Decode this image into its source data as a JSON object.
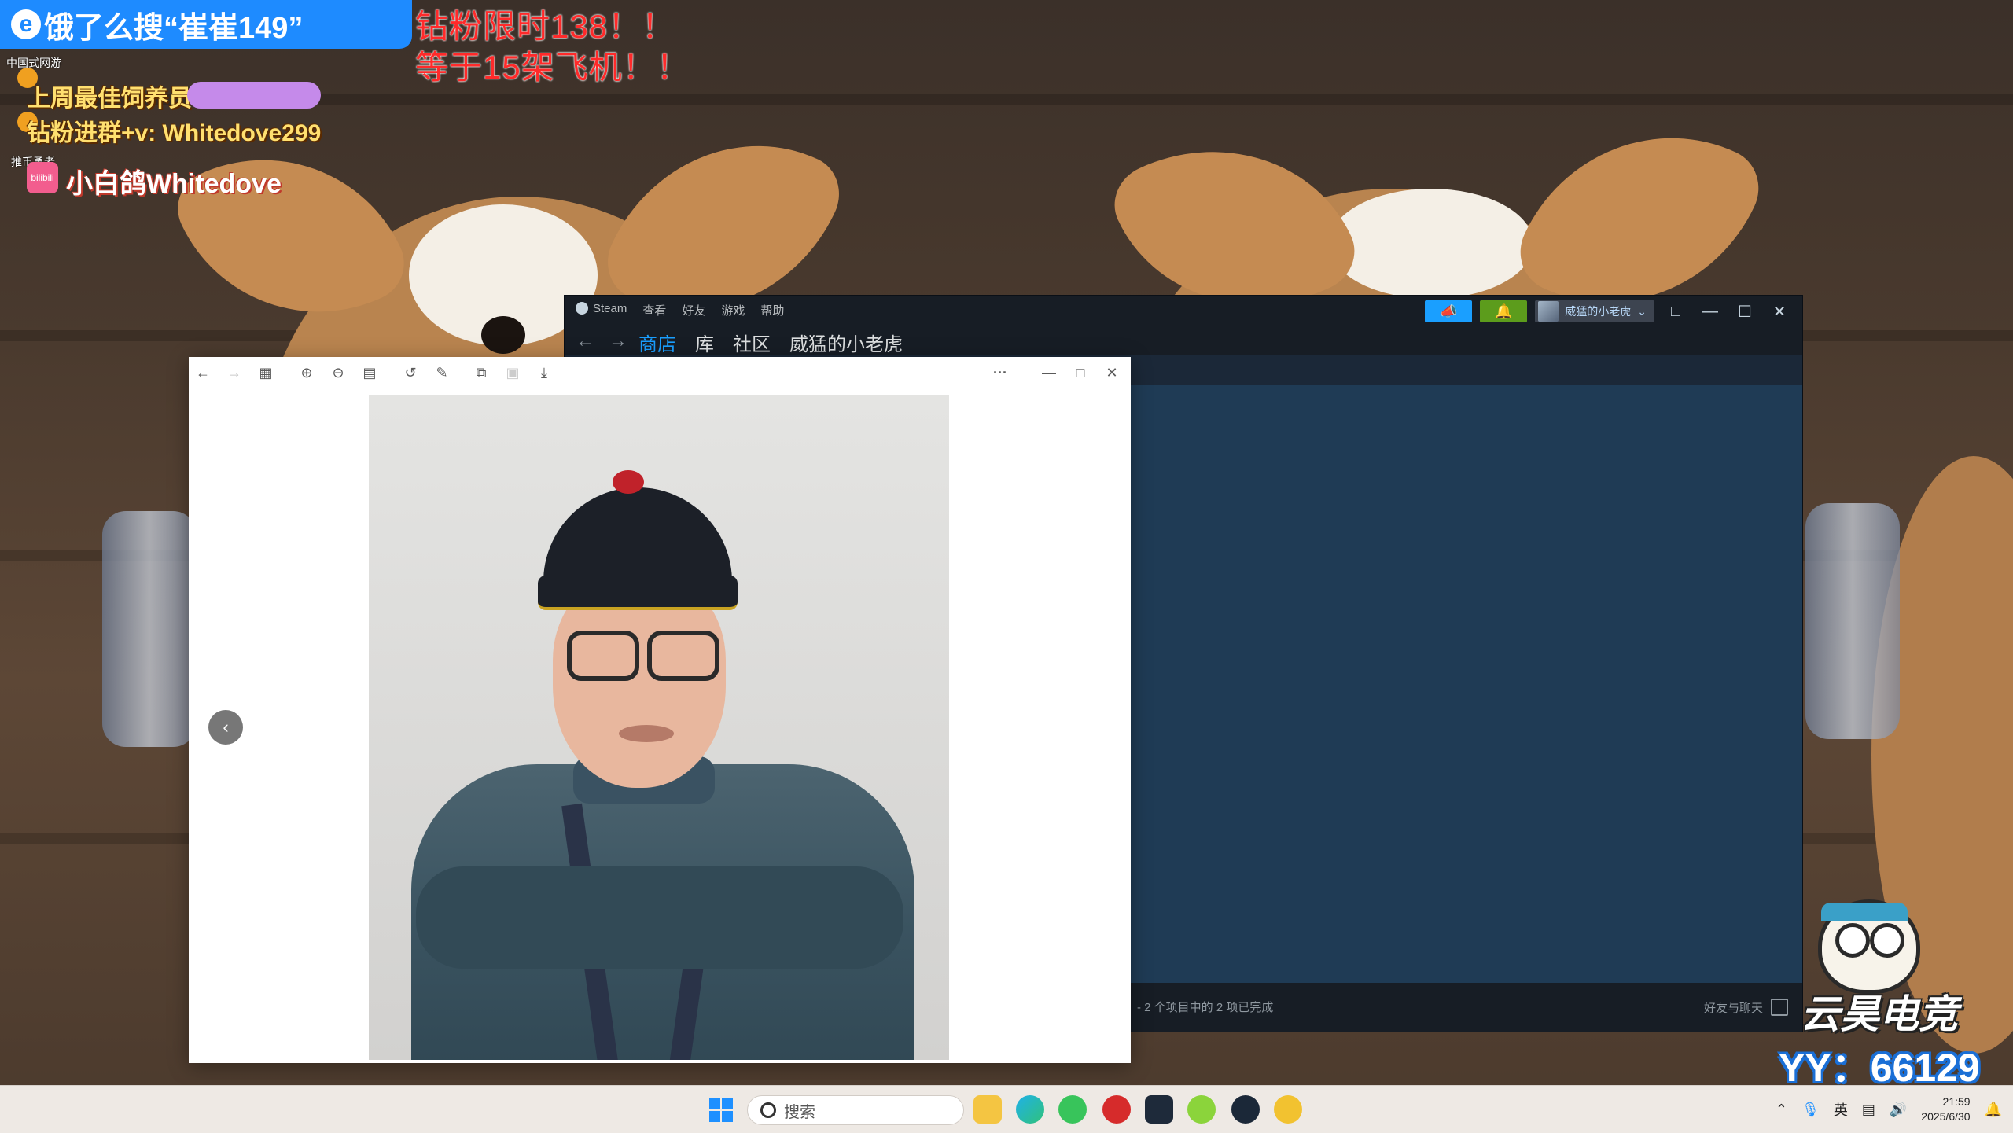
{
  "overlay": {
    "promo_text": "饿了么搜“崔崔149”",
    "red_line1": "钻粉限时138！！",
    "red_line2": "等于15架飞机！！",
    "tag_top": "中国式网游",
    "tag_side": "推币勇者",
    "best_feeder_label": "上周最佳饲养员",
    "group_text": "钻粉进群+v: Whitedove299",
    "bili_icon_text": "bilibili",
    "bili_name": "小白鸽Whitedove",
    "brand": "云昊电竞",
    "yy": "YY：66129"
  },
  "steam": {
    "menu": [
      "Steam",
      "查看",
      "好友",
      "游戏",
      "帮助"
    ],
    "tabs": [
      "商店",
      "库",
      "社区",
      "威猛的小老虎"
    ],
    "active_tab": "商店",
    "username": "威猛的小老虎",
    "status_text": "- 2 个项目中的 2 项已完成",
    "friends_label": "好友与聊天",
    "colors": {
      "accent": "#1a9fff",
      "notify": "#5c9c1c",
      "bg": "#1b2838"
    }
  },
  "viewer": {
    "toolbar_icons": [
      "back-icon",
      "forward-icon",
      "gallery-icon",
      "zoom-in-icon",
      "zoom-out-icon",
      "actual-size-icon",
      "rotate-icon",
      "edit-icon",
      "copy-icon",
      "crop-icon",
      "save-icon",
      "more-icon",
      "minimize-icon",
      "maximize-icon",
      "close-icon"
    ],
    "more_glyph": "···"
  },
  "taskbar": {
    "search_placeholder": "搜索",
    "ime": "英",
    "time": "21:59",
    "date": "2025/6/30",
    "apps": [
      "file-explorer",
      "edge",
      "wechat",
      "netease-music",
      "terminal",
      "game-app",
      "steam",
      "owl-app"
    ]
  }
}
